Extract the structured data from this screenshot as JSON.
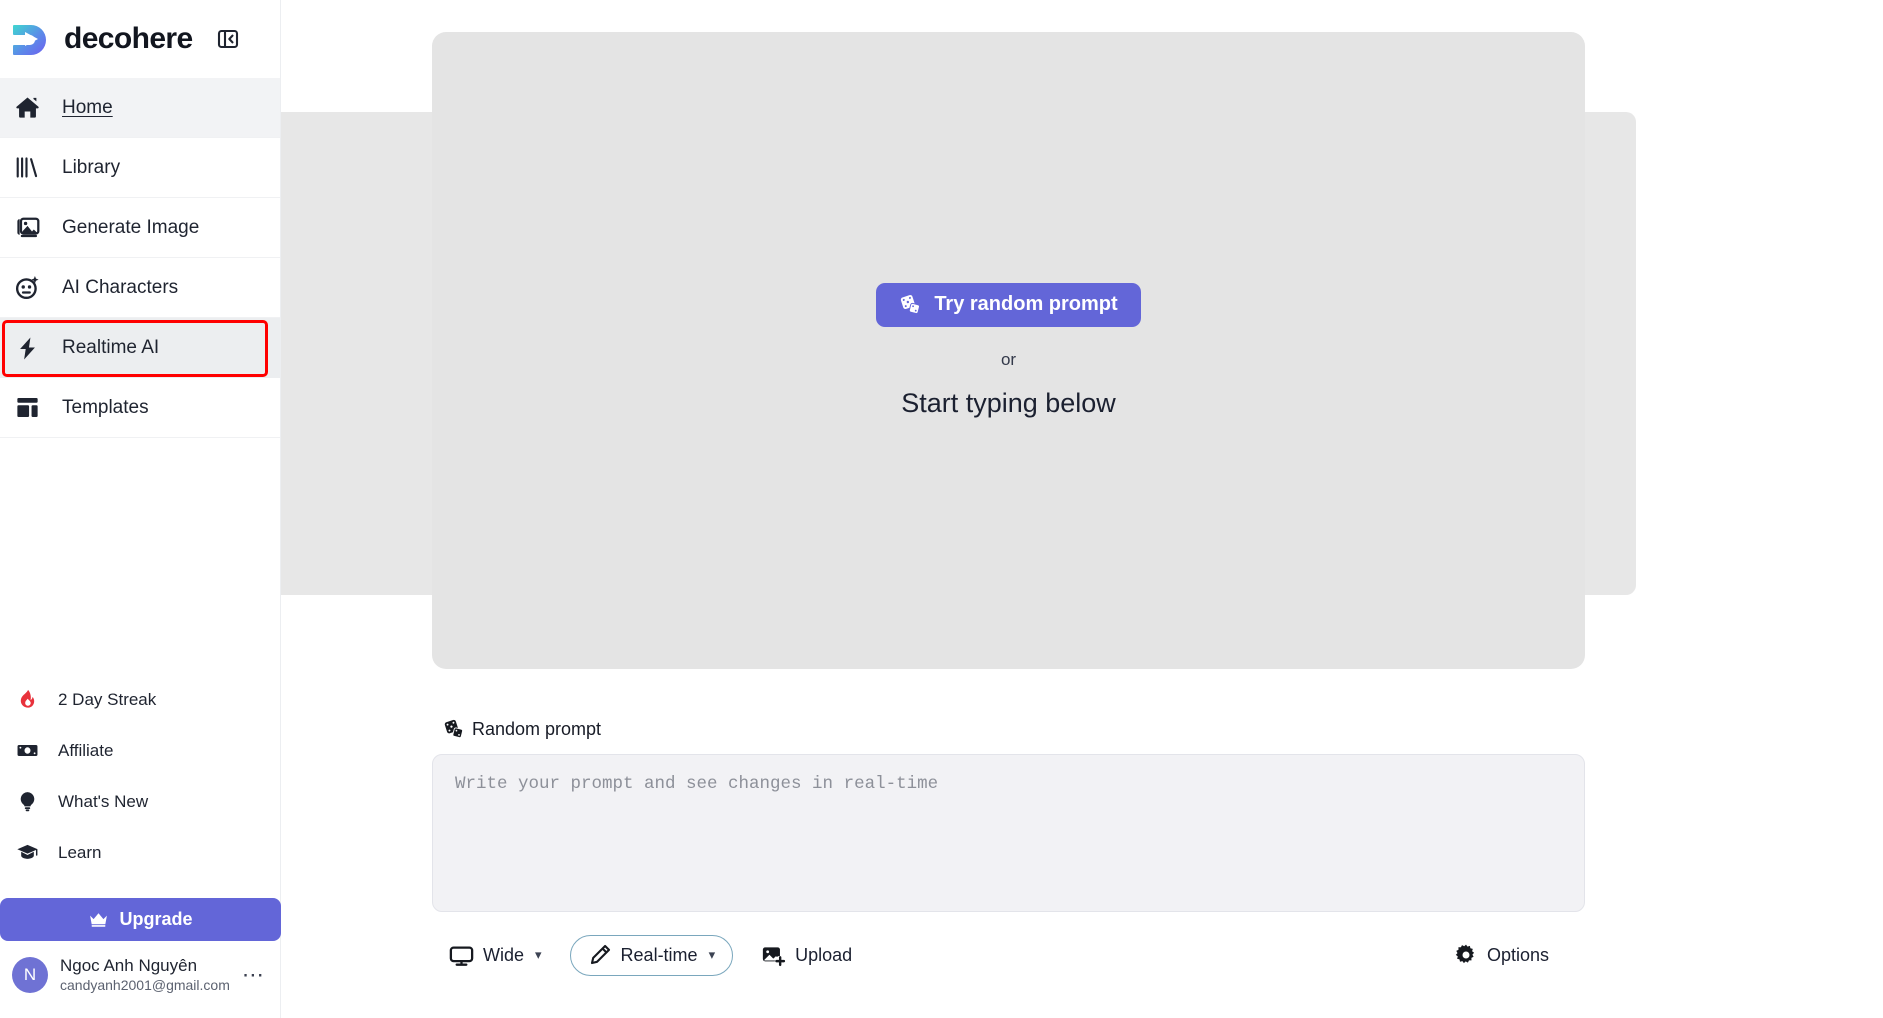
{
  "brand": {
    "name": "decohere",
    "logo_icon": "decohere-play-logo",
    "collapse_icon": "sidebar-collapse-icon"
  },
  "sidebar": {
    "nav_items": [
      {
        "label": "Home",
        "icon": "home-icon",
        "state": "active"
      },
      {
        "label": "Library",
        "icon": "library-icon",
        "state": "default"
      },
      {
        "label": "Generate Image",
        "icon": "generate-image-icon",
        "state": "default"
      },
      {
        "label": "AI Characters",
        "icon": "ai-characters-icon",
        "state": "default"
      },
      {
        "label": "Realtime AI",
        "icon": "lightning-bolt-icon",
        "state": "current-highlighted"
      },
      {
        "label": "Templates",
        "icon": "templates-icon",
        "state": "default"
      }
    ],
    "highlight_color": "#ff0000",
    "utility_items": [
      {
        "label": "2 Day Streak",
        "icon": "flame-icon",
        "icon_color": "#e8323c"
      },
      {
        "label": "Affiliate",
        "icon": "money-icon",
        "icon_color": "#1f2430"
      },
      {
        "label": "What's New",
        "icon": "lightbulb-icon",
        "icon_color": "#1f2430"
      },
      {
        "label": "Learn",
        "icon": "graduation-cap-icon",
        "icon_color": "#1f2430"
      }
    ],
    "upgrade": {
      "label": "Upgrade",
      "icon": "crown-icon",
      "color": "#6366d8"
    },
    "user": {
      "avatar_initial": "N",
      "avatar_color": "#6f72d4",
      "name": "Ngoc Anh Nguyên",
      "email": "candyanh2001@gmail.com",
      "menu_icon": "ellipsis-icon"
    }
  },
  "main": {
    "canvas": {
      "try_random_prompt": {
        "label": "Try random prompt",
        "icon": "dice-icon",
        "color": "#6366d8"
      },
      "or_text": "or",
      "start_text": "Start typing below",
      "placeholder_color": "#e4e4e4"
    },
    "side_cards": {
      "count": 2,
      "color": "#e7e7e7"
    },
    "prompt": {
      "random_prompt_label": "Random prompt",
      "random_prompt_icon": "dice-icon",
      "textarea_value": "",
      "textarea_placeholder": "Write your prompt and see changes in real-time"
    },
    "toolbar": [
      {
        "label": "Wide",
        "icon": "monitor-icon",
        "has_chevron": true,
        "boxed": false
      },
      {
        "label": "Real-time",
        "icon": "pencil-icon",
        "has_chevron": true,
        "boxed": true
      },
      {
        "label": "Upload",
        "icon": "upload-image-icon",
        "has_chevron": false,
        "boxed": false
      },
      {
        "label": "Options",
        "icon": "gear-icon",
        "has_chevron": false,
        "boxed": false
      }
    ]
  }
}
